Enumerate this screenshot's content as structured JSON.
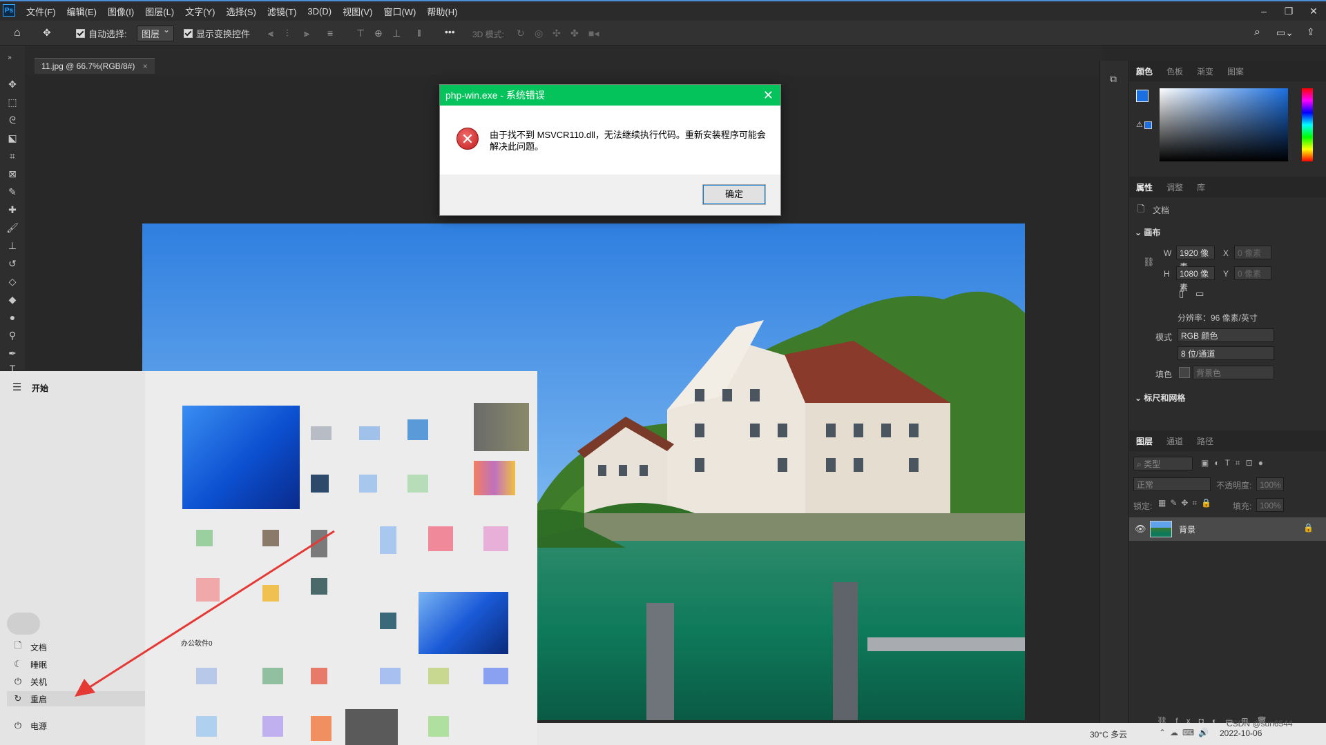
{
  "app": {
    "logo": "Ps",
    "menu": [
      "文件(F)",
      "编辑(E)",
      "图像(I)",
      "图层(L)",
      "文字(Y)",
      "选择(S)",
      "滤镜(T)",
      "3D(D)",
      "视图(V)",
      "窗口(W)",
      "帮助(H)"
    ]
  },
  "options": {
    "auto_select_label": "自动选择:",
    "auto_select_value": "图层",
    "show_transform_label": "显示变换控件",
    "mode_3d_label": "3D 模式:"
  },
  "document": {
    "tab_label": "11.jpg @ 66.7%(RGB/8#)"
  },
  "color_panel": {
    "tabs": [
      "颜色",
      "色板",
      "渐变",
      "图案"
    ]
  },
  "properties_panel": {
    "tabs": [
      "属性",
      "调整",
      "库"
    ],
    "doc_label": "文档",
    "canvas_section": "画布",
    "w_label": "W",
    "w_value": "1920 像素",
    "h_label": "H",
    "h_value": "1080 像素",
    "x_label": "X",
    "x_placeholder": "0 像素",
    "y_label": "Y",
    "y_placeholder": "0 像素",
    "resolution": "分辨率：96 像素/英寸",
    "mode_label": "模式",
    "mode_value": "RGB 颜色",
    "depth_value": "8 位/通道",
    "fill_label": "填色",
    "fill_value": "背景色",
    "rulers_section": "标尺和网格"
  },
  "layers_panel": {
    "tabs": [
      "图层",
      "通道",
      "路径"
    ],
    "search_placeholder": "类型",
    "blend_mode": "正常",
    "opacity_label": "不透明度:",
    "opacity_value": "100%",
    "lock_label": "锁定:",
    "fill_label": "填充:",
    "fill_value": "100%",
    "layer_name": "背景"
  },
  "dialog": {
    "title": "php-win.exe - 系统错误",
    "message": "由于找不到 MSVCR110.dll，无法继续执行代码。重新安装程序可能会解决此问题。",
    "ok_label": "确定"
  },
  "start_menu": {
    "title": "开始",
    "items": [
      "文档",
      "睡眠",
      "关机",
      "重启"
    ],
    "power_label": "电源",
    "app_label": "办公软件0"
  },
  "taskbar": {
    "weather": "30°C 多云",
    "date": "2022-10-06",
    "watermark": "CSDN @sun6544"
  },
  "colors": {
    "foreground": "#1b6fe0",
    "dialog_title_bg": "#05c35b",
    "arrow": "#e53935"
  }
}
